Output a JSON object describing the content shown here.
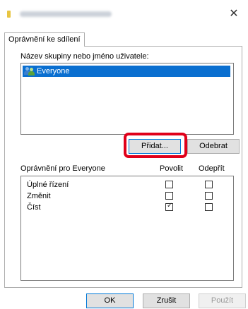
{
  "window": {
    "title": "",
    "close_glyph": "✕"
  },
  "tab": {
    "label": "Oprávnění ke sdílení"
  },
  "group_section": {
    "label": "Název skupiny nebo jméno uživatele:",
    "users": [
      {
        "name": "Everyone",
        "icon": "users-group-icon",
        "selected": true
      }
    ],
    "add_button": "Přidat...",
    "remove_button": "Odebrat"
  },
  "permissions": {
    "label": "Oprávnění pro Everyone",
    "allow_header": "Povolit",
    "deny_header": "Odepřít",
    "rows": [
      {
        "name": "Úplné řízení",
        "allow": false,
        "deny": false
      },
      {
        "name": "Změnit",
        "allow": false,
        "deny": false
      },
      {
        "name": "Číst",
        "allow": true,
        "deny": false
      }
    ]
  },
  "footer": {
    "ok": "OK",
    "cancel": "Zrušit",
    "apply": "Použít"
  },
  "accent": {
    "selection": "#0a6fd0",
    "highlight": "#e0001a",
    "focus": "#0078d7"
  }
}
